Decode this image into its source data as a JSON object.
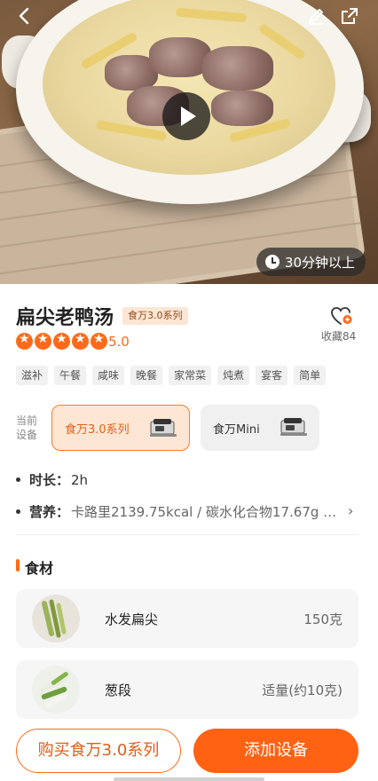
{
  "hero": {
    "duration": "30分钟以上",
    "icons": [
      "back-icon",
      "edit-icon",
      "share-icon",
      "play-icon",
      "clock-icon"
    ]
  },
  "recipe": {
    "title": "扁尖老鸭汤",
    "series_badge": "食万3.0系列",
    "rating": "5.0",
    "stars": 5,
    "favorite_label": "收藏84",
    "tags": [
      "滋补",
      "午餐",
      "咸味",
      "晚餐",
      "家常菜",
      "炖煮",
      "宴客",
      "简单"
    ]
  },
  "device": {
    "label": "当前设备",
    "options": [
      {
        "name": "食万3.0系列",
        "selected": true
      },
      {
        "name": "食万Mini",
        "selected": false
      }
    ]
  },
  "info": {
    "duration_key": "时长：",
    "duration_val": "2h",
    "nutrition_key": "营养：",
    "nutrition_val": "卡路里2139.75kcal / 碳水化合物17.67g …"
  },
  "ingredients": {
    "title": "食材",
    "items": [
      {
        "name": "水发扁尖",
        "qty": "150克"
      },
      {
        "name": "葱段",
        "qty": "适量(约10克)"
      }
    ]
  },
  "actions": {
    "buy": "购买食万3.0系列",
    "add": "添加设备"
  },
  "colors": {
    "accent": "#ff6213",
    "accent_light": "#fde6d3"
  }
}
